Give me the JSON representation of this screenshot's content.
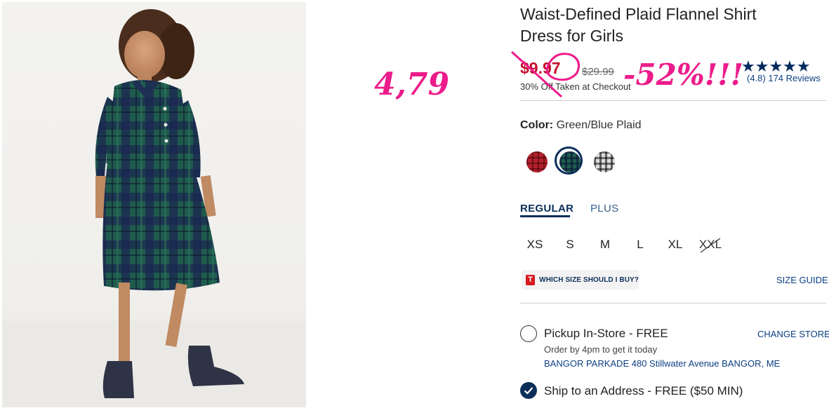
{
  "product": {
    "title_line1": "Waist-Defined Plaid Flannel Shirt",
    "title_line2": "Dress for Girls",
    "sale_price": "$9.97",
    "original_price": "$29.99",
    "checkout_note": "30% Off Taken at Checkout",
    "rating_stars": "★★★★★",
    "rating_value": 4.8,
    "reviews_text": "(4.8) 174 Reviews"
  },
  "annotations": {
    "handwritten_price": "4,79",
    "handwritten_discount": "-52%!!!",
    "color": "#ec1c8b"
  },
  "color_selector": {
    "label": "Color:",
    "selected_value": "Green/Blue Plaid",
    "swatches": [
      "red-plaid",
      "green-blue-plaid",
      "black-white-plaid"
    ]
  },
  "fit_tabs": [
    {
      "label": "REGULAR",
      "active": true
    },
    {
      "label": "PLUS",
      "active": false
    }
  ],
  "sizes": [
    {
      "label": "XS",
      "available": true
    },
    {
      "label": "S",
      "available": true
    },
    {
      "label": "M",
      "available": true
    },
    {
      "label": "L",
      "available": true
    },
    {
      "label": "XL",
      "available": true
    },
    {
      "label": "XXL",
      "available": false
    }
  ],
  "size_help": {
    "badge": "T",
    "label": "WHICH SIZE SHOULD I BUY?",
    "guide_link": "SIZE GUIDE"
  },
  "fulfillment": {
    "pickup": {
      "label": "Pickup In-Store - FREE",
      "selected": false,
      "change_store": "CHANGE STORE",
      "order_by": "Order by 4pm to get it today",
      "store_address": "BANGOR PARKADE 480 Stillwater Avenue  BANGOR, ME"
    },
    "ship": {
      "label": "Ship to an Address - FREE ($50 MIN)",
      "selected": true
    }
  },
  "colors": {
    "brand_navy": "#0c2f5a",
    "sale_red": "#c4102e",
    "link_blue": "#0c3f82"
  }
}
